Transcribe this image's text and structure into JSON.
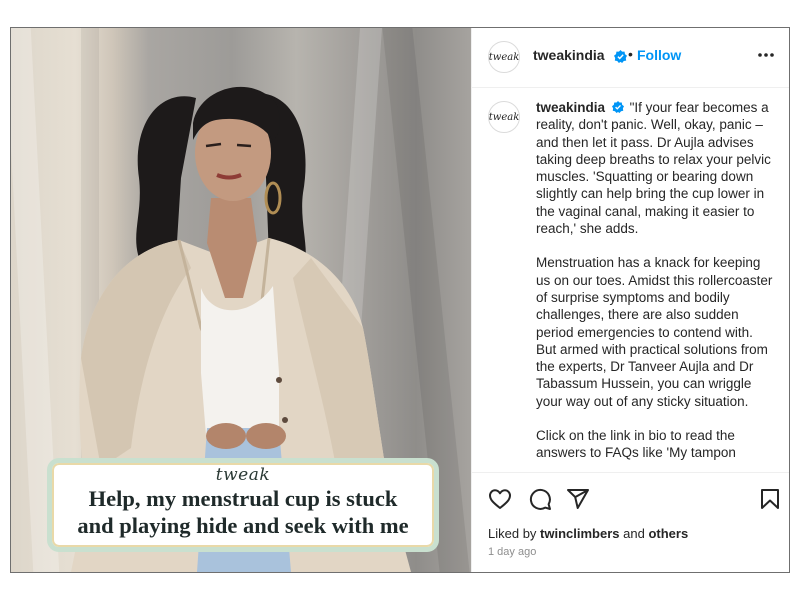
{
  "post": {
    "overlay": {
      "brand": "tweak",
      "headline_line1": "Help, my menstrual cup is stuck",
      "headline_line2": "and playing hide and seek with me"
    }
  },
  "header": {
    "avatar_text": "tweak",
    "username": "tweakindia",
    "separator": "•",
    "follow_label": "Follow"
  },
  "caption": {
    "avatar_text": "tweak",
    "username": "tweakindia",
    "paragraph1": "\"If your fear becomes a reality, don't panic. Well, okay, panic – and then let it pass. Dr Aujla advises taking deep breaths to relax your pelvic muscles. 'Squatting or bearing down slightly can help bring the cup lower in the vaginal canal, making it easier to reach,' she adds.",
    "paragraph2": "Menstruation has a knack for keeping us on our toes. Amidst this rollercoaster of surprise symptoms and bodily challenges, there are also sudden period emergencies to contend with. But armed with practical solutions from the experts, Dr Tanveer Aujla and Dr Tabassum Hussein, you can wriggle your way out of any sticky situation.",
    "paragraph3": "Click on the link in bio to read the answers to FAQs like 'My tampon"
  },
  "footer": {
    "liked_prefix": "Liked by ",
    "liked_user": "twinclimbers",
    "liked_mid": " and ",
    "liked_suffix": "others",
    "timestamp": "1 day ago"
  },
  "icons": {
    "like": "heart-icon",
    "comment": "comment-icon",
    "share": "paper-plane-icon",
    "save": "bookmark-icon",
    "more": "more-options-icon",
    "verified": "verified-badge-icon"
  },
  "colors": {
    "accent": "#0095f6",
    "text": "#262626",
    "muted": "#8e8e8e"
  }
}
